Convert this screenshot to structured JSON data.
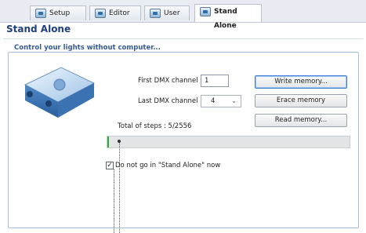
{
  "tabs": [
    {
      "label": "Setup",
      "icon": "setup-icon"
    },
    {
      "label": "Editor",
      "icon": "editor-icon"
    },
    {
      "label": "User",
      "icon": "user-icon"
    },
    {
      "label": "Stand Alone",
      "icon": "stand-alone-icon",
      "active": true
    }
  ],
  "panel": {
    "title": "Stand Alone",
    "subtitle": "Control your lights without computer..."
  },
  "form": {
    "first_dmx_label": "First DMX channel",
    "first_dmx_value": "1",
    "last_dmx_label": "Last DMX channel",
    "last_dmx_value": "4",
    "total_steps_label": "Total of steps : 5/2556"
  },
  "buttons": {
    "write": "Write memory...",
    "erase": "Erace memory",
    "read": "Read memory..."
  },
  "progress": {
    "fraction": 0.007
  },
  "checkbox": {
    "label": "Do not go in \"Stand Alone\" now",
    "checked": true,
    "mark": "✓"
  },
  "colors": {
    "title": "#1f3f7c",
    "subtitle": "#355b95",
    "progress": "#2da842",
    "focus": "#3e7dd0"
  }
}
